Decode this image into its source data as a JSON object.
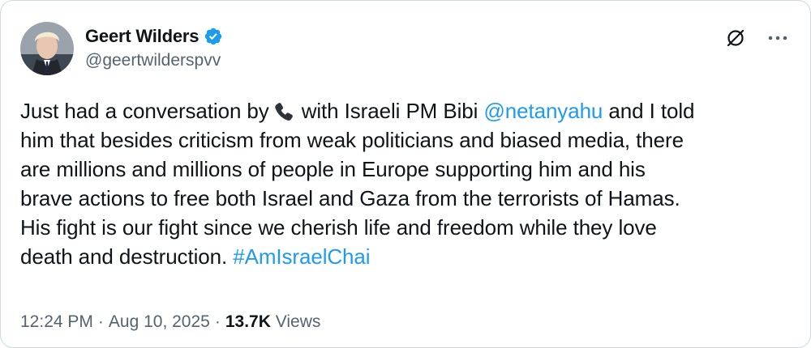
{
  "author": {
    "display_name": "Geert Wilders",
    "handle": "@geertwilderspvv",
    "verified": true,
    "verified_color": "#1d9bf0"
  },
  "actions": {
    "grok_icon": "grok-slash-circle-icon",
    "more_icon": "more-dots-icon"
  },
  "tweet": {
    "segment_1": "Just had a conversation by",
    "emoji_icon": "telephone-receiver-icon",
    "segment_2": "with Israeli PM Bibi",
    "mention": "@netanyahu",
    "segment_3": "and I told",
    "line_2": "him that besides criticism from weak politicians and biased media, there",
    "line_3": "are millions and millions of people in Europe supporting him and his",
    "line_4": "brave actions to free both Israel and Gaza from the terrorists of Hamas.",
    "line_5": "His fight is our fight since we cherish life and freedom while they love",
    "line_6_text": "death and destruction.",
    "hashtag": "#AmIsraelChai",
    "link_color": "#1d9bf0"
  },
  "meta": {
    "time": "12:24 PM",
    "date": "Aug 10, 2025",
    "separator": "·",
    "views_count": "13.7K",
    "views_label": "Views"
  }
}
